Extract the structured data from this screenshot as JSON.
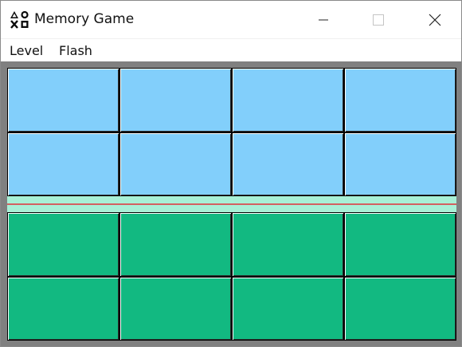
{
  "window": {
    "title": "Memory Game",
    "icon": "memory-game-app-icon"
  },
  "menu": {
    "items": [
      {
        "label": "Level"
      },
      {
        "label": "Flash"
      }
    ]
  },
  "game": {
    "top_cards": {
      "count": 8,
      "color": "#82cffb",
      "state": "face-down"
    },
    "bottom_cards": {
      "count": 8,
      "color": "#12b981",
      "state": "face-down"
    },
    "divider_color": "#a8f0d6",
    "divider_line_color": "#d46060",
    "background_color": "#808080"
  }
}
